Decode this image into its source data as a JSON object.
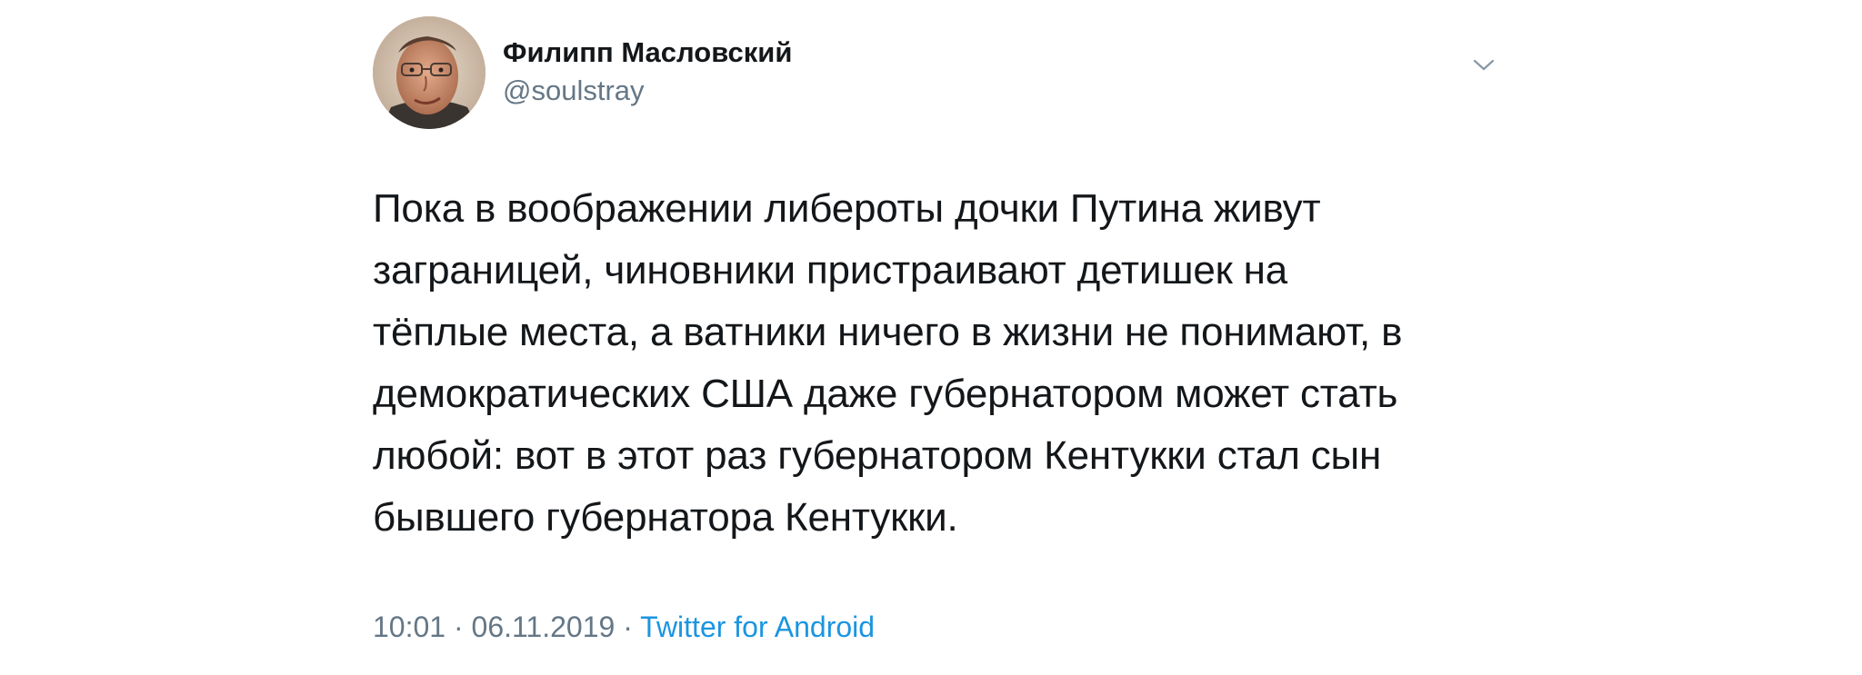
{
  "tweet": {
    "display_name": "Филипп Масловский",
    "handle": "@soulstray",
    "text": "Пока в воображении либероты дочки Путина живут\nзаграницей, чиновники пристраивают детишек на\nтёплые места, а ватники ничего в жизни не понимают, в\nдемократических США даже губернатором может стать\nлюбой: вот в этот раз губернатором Кентукки стал сын\nбывшего губернатора Кентукки.",
    "time": "10:01",
    "separator1": "·",
    "date": "06.11.2019",
    "separator2": "·",
    "source": "Twitter for Android"
  },
  "colors": {
    "text": "#14171a",
    "secondary": "#657786",
    "link": "#1b95e0",
    "background": "#ffffff"
  },
  "icons": {
    "menu": "chevron-down-icon",
    "avatar": "user-photo"
  }
}
